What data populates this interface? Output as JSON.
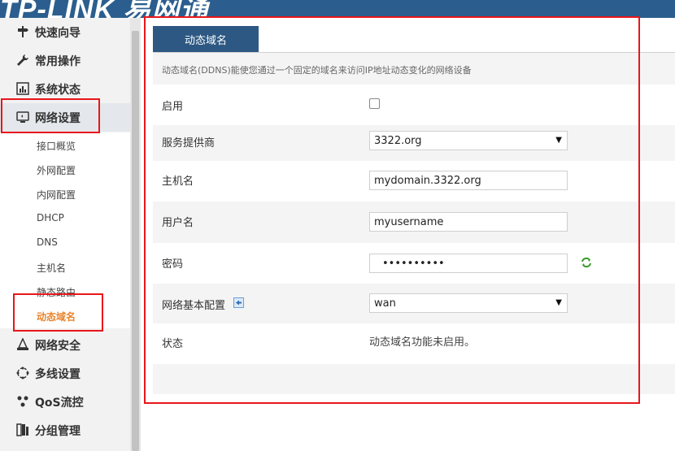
{
  "header": {
    "brand": "TP-LINK 易网通"
  },
  "sidebar": {
    "items": [
      {
        "label": "快速向导",
        "icon": "signpost-icon"
      },
      {
        "label": "常用操作",
        "icon": "wrench-icon"
      },
      {
        "label": "系统状态",
        "icon": "bar-chart-icon"
      },
      {
        "label": "网络设置",
        "icon": "monitor-icon"
      },
      {
        "label": "网络安全",
        "icon": "shield-icon"
      },
      {
        "label": "多线设置",
        "icon": "multi-line-icon"
      },
      {
        "label": "QoS流控",
        "icon": "qos-icon"
      },
      {
        "label": "分组管理",
        "icon": "group-icon"
      }
    ],
    "sub_items": [
      {
        "label": "接口概览"
      },
      {
        "label": "外网配置"
      },
      {
        "label": "内网配置"
      },
      {
        "label": "DHCP"
      },
      {
        "label": "DNS"
      },
      {
        "label": "主机名"
      },
      {
        "label": "静态路由"
      },
      {
        "label": "动态域名"
      }
    ]
  },
  "tab": {
    "label": "动态域名"
  },
  "description": "动态域名(DDNS)能使您通过一个固定的域名来访问IP地址动态变化的网络设备",
  "form": {
    "enable": {
      "label": "启用",
      "checked": false
    },
    "provider": {
      "label": "服务提供商",
      "value": "3322.org"
    },
    "hostname": {
      "label": "主机名",
      "value": "mydomain.3322.org"
    },
    "username": {
      "label": "用户名",
      "value": "myusername"
    },
    "password": {
      "label": "密码",
      "value": "••••••••••"
    },
    "base_config": {
      "label": "网络基本配置",
      "value": "wan"
    },
    "status": {
      "label": "状态",
      "value": "动态域名功能未启用。"
    }
  },
  "colors": {
    "accent_blue": "#2d5883",
    "active_orange": "#e8842d",
    "highlight_red": "#e8161b",
    "refresh_green": "#3a9a2a"
  }
}
